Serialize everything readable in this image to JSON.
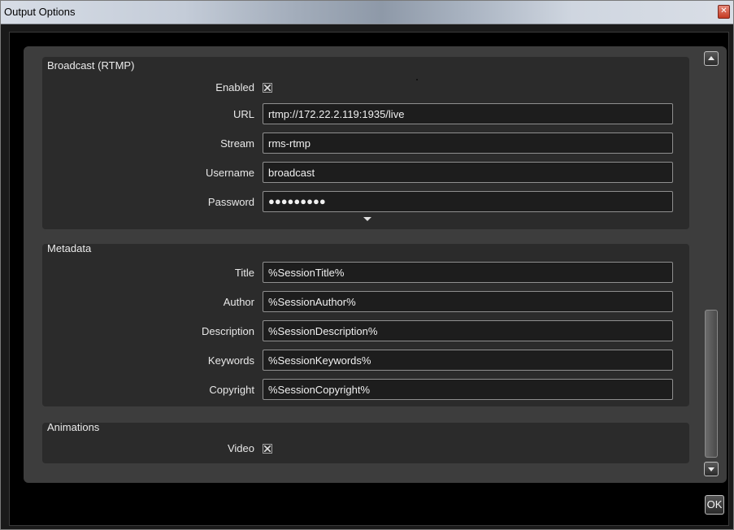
{
  "window": {
    "title": "Output Options",
    "close_glyph": "✕"
  },
  "broadcast": {
    "title": "Broadcast (RTMP)",
    "enabled_label": "Enabled",
    "enabled_checked": true,
    "url_label": "URL",
    "url_value": "rtmp://172.22.2.119:1935/live",
    "stream_label": "Stream",
    "stream_value": "rms-rtmp",
    "username_label": "Username",
    "username_value": "broadcast",
    "password_label": "Password",
    "password_value": "●●●●●●●●●"
  },
  "metadata": {
    "title": "Metadata",
    "title_label": "Title",
    "title_value": "%SessionTitle%",
    "author_label": "Author",
    "author_value": "%SessionAuthor%",
    "description_label": "Description",
    "description_value": "%SessionDescription%",
    "keywords_label": "Keywords",
    "keywords_value": "%SessionKeywords%",
    "copyright_label": "Copyright",
    "copyright_value": "%SessionCopyright%"
  },
  "animations": {
    "title": "Animations",
    "video_label": "Video",
    "video_checked": true
  },
  "footer": {
    "ok_label": "OK"
  },
  "icons": {
    "close": "close-icon",
    "scroll_up": "scroll-up-icon",
    "scroll_down": "scroll-down-icon",
    "collapse": "chevron-down-icon",
    "check": "check-x-icon"
  }
}
